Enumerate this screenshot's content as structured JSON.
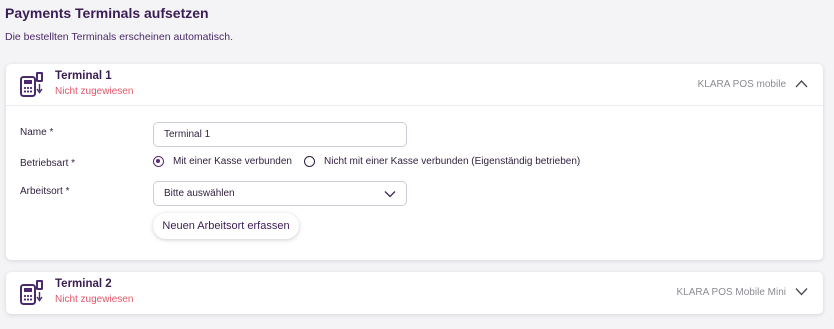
{
  "header": {
    "title": "Payments Terminals aufsetzen",
    "subtitle": "Die bestellten Terminals erscheinen automatisch."
  },
  "colors": {
    "primary": "#3b1d55",
    "status_unassigned": "#e0566a",
    "muted": "#8b8b92",
    "page_bg": "#f4f4f6"
  },
  "terminals": [
    {
      "title": "Terminal 1",
      "status": "Nicht zugewiesen",
      "model": "KLARA POS mobile",
      "expanded": true,
      "toggle_icon": "chevron-up-icon",
      "form": {
        "name_label": "Name *",
        "name_value": "Terminal 1",
        "mode_label": "Betriebsart *",
        "mode_options": [
          {
            "label": "Mit einer Kasse verbunden",
            "checked": true
          },
          {
            "label": "Nicht mit einer Kasse verbunden (Eigenständig betrieben)",
            "checked": false
          }
        ],
        "location_label": "Arbeitsort *",
        "location_value": "Bitte auswählen",
        "new_location_button": "Neuen Arbeitsort erfassen"
      }
    },
    {
      "title": "Terminal 2",
      "status": "Nicht zugewiesen",
      "model": "KLARA POS Mobile Mini",
      "expanded": false,
      "toggle_icon": "chevron-down-icon"
    }
  ]
}
